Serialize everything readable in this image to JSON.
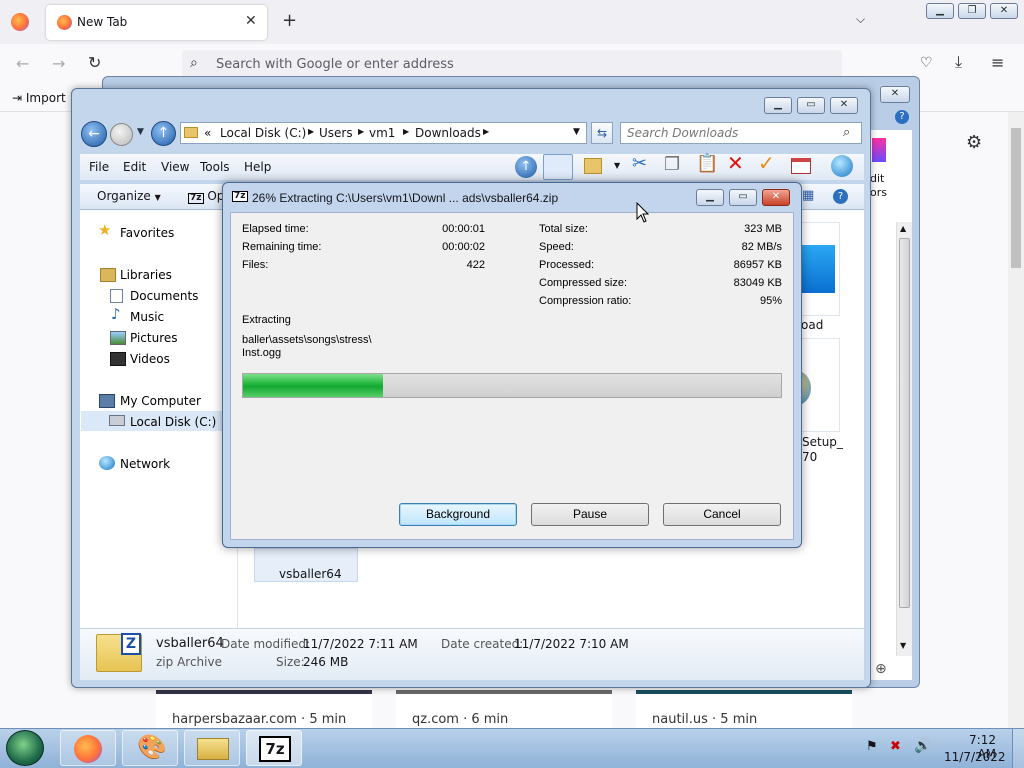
{
  "browser": {
    "tab_title": "New Tab",
    "address_placeholder": "Search with Google or enter address",
    "bookmark_import": "Import",
    "tiles": [
      {
        "label": "harpersbazaar.com · 5 min"
      },
      {
        "label": "qz.com · 6 min"
      },
      {
        "label": "nautil.us · 5 min"
      }
    ],
    "side_labels": [
      "dit",
      "ors"
    ]
  },
  "explorer": {
    "breadcrumb": [
      "«",
      "Local Disk (C:)",
      "Users",
      "vm1",
      "Downloads"
    ],
    "search_placeholder": "Search Downloads",
    "menu": [
      "File",
      "Edit",
      "View",
      "Tools",
      "Help"
    ],
    "organize": "Organize",
    "open_partial": "Op",
    "nav": {
      "favorites": "Favorites",
      "libraries": "Libraries",
      "documents": "Documents",
      "music": "Music",
      "pictures": "Pictures",
      "videos": "Videos",
      "my_computer": "My Computer",
      "local_disk": "Local Disk (C:)",
      "network": "Network"
    },
    "files": {
      "file1_label": "vsballer64",
      "partial1": "oad",
      "partial2a": "Setup_",
      "partial2b": "70"
    },
    "details": {
      "name": "vsballer64",
      "type": "zip Archive",
      "modified_label": "Date modified:",
      "modified_value": "11/7/2022 7:11 AM",
      "created_label": "Date created:",
      "created_value": "11/7/2022 7:10 AM",
      "size_label": "Size:",
      "size_value": "246 MB"
    }
  },
  "dialog": {
    "title": "26% Extracting C:\\Users\\vm1\\Downl ... ads\\vsballer64.zip",
    "left": [
      {
        "label": "Elapsed time:",
        "value": "00:00:01"
      },
      {
        "label": "Remaining time:",
        "value": "00:00:02"
      },
      {
        "label": "Files:",
        "value": "422"
      }
    ],
    "right": [
      {
        "label": "Total size:",
        "value": "323 MB"
      },
      {
        "label": "Speed:",
        "value": "82 MB/s"
      },
      {
        "label": "Processed:",
        "value": "86957 KB"
      },
      {
        "label": "Compressed size:",
        "value": "83049 KB"
      },
      {
        "label": "Compression ratio:",
        "value": "95%"
      }
    ],
    "status": "Extracting",
    "path_line1": "baller\\assets\\songs\\stress\\",
    "path_line2": "Inst.ogg",
    "progress": 0.26,
    "buttons": {
      "background": "Background",
      "pause": "Pause",
      "cancel": "Cancel"
    }
  },
  "taskbar": {
    "time": "7:12 AM",
    "date": "11/7/2022",
    "sevenzip_label": "7z"
  },
  "colors": {
    "progress_green": "#1fb53a",
    "accent_blue": "#3c7fb1"
  }
}
